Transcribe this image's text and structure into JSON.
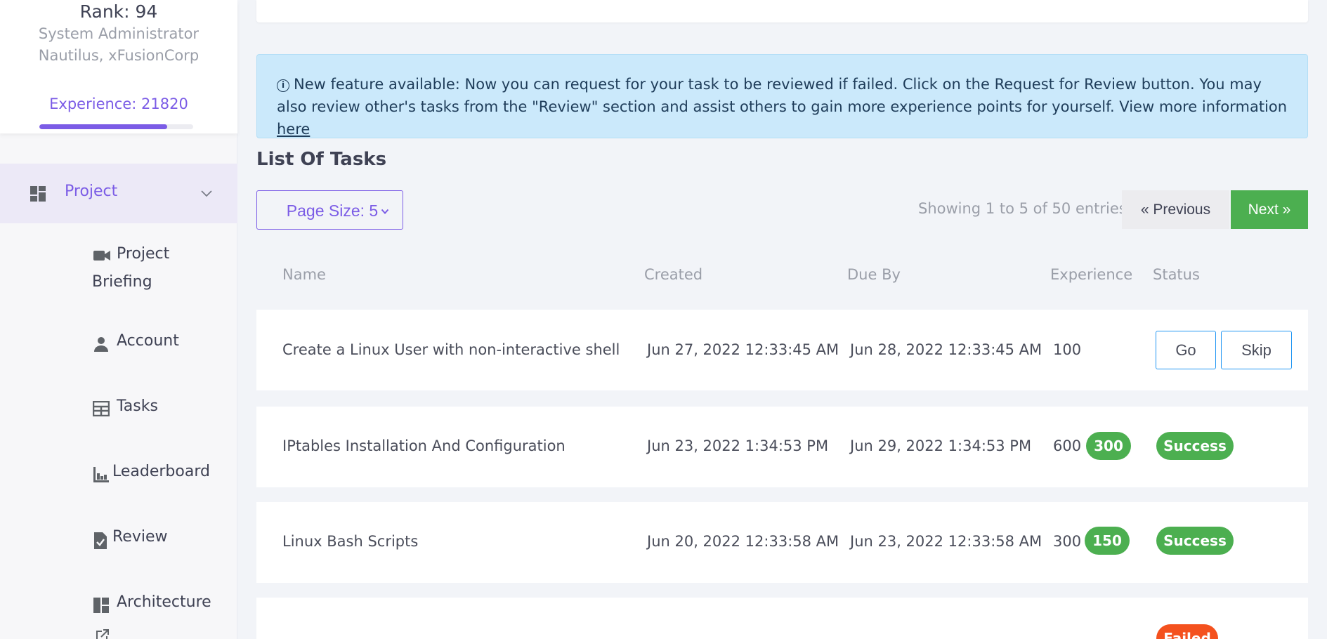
{
  "profile": {
    "rank": "Rank: 94",
    "role": "System Administrator",
    "organization": "Nautilus, xFusionCorp",
    "experience": "Experience: 21820",
    "experience_progress": 0.83
  },
  "sidebar": {
    "project": {
      "label": "Project",
      "icon": "dashboard-icon"
    },
    "items": [
      {
        "label_line1": "Project",
        "label_line2": "Briefing",
        "icon": "video-camera-icon"
      },
      {
        "label": "Account",
        "icon": "person-icon"
      },
      {
        "label": "Tasks",
        "icon": "table-icon"
      },
      {
        "label": "Leaderboard",
        "icon": "bar-chart-icon"
      },
      {
        "label": "Review",
        "icon": "document-check-icon"
      },
      {
        "label": "Architecture",
        "icon": "dashboard-icon"
      }
    ]
  },
  "alert": {
    "text": "New feature available: Now you can request for your task to be reviewed if failed. Click on the Request for Review button. You may also review other's tasks from the \"Review\" section and assist others to gain more experience points for yourself. View more information ",
    "link_text": "here"
  },
  "list": {
    "title": "List Of Tasks",
    "page_size": "Page Size: 5",
    "showing": "Showing 1 to 5 of 50 entries",
    "prev": "« Previous",
    "next": "Next »"
  },
  "table": {
    "headers": {
      "name": "Name",
      "created": "Created",
      "due": "Due By",
      "experience": "Experience",
      "status": "Status"
    },
    "rows": [
      {
        "name": "Create a Linux User with non-interactive shell",
        "created": "Jun 27, 2022 12:33:45 AM",
        "due": "Jun 28, 2022 12:33:45 AM",
        "experience": "100",
        "go": "Go",
        "skip": "Skip"
      },
      {
        "name": "IPtables Installation And Configuration",
        "created": "Jun 23, 2022 1:34:53 PM",
        "due": "Jun 29, 2022 1:34:53 PM",
        "experience": "600",
        "bonus": "300",
        "status": "Success"
      },
      {
        "name": "Linux Bash Scripts",
        "created": "Jun 20, 2022 12:33:58 AM",
        "due": "Jun 23, 2022 12:33:58 AM",
        "experience": "300",
        "bonus": "150",
        "status": "Success"
      },
      {
        "status": "Failed"
      }
    ]
  },
  "colors": {
    "accent": "#7b5ce6",
    "success": "#4caf50",
    "failed": "#f4511e",
    "info_bg": "#cbe9fb",
    "outline_button": "#2196f3"
  }
}
